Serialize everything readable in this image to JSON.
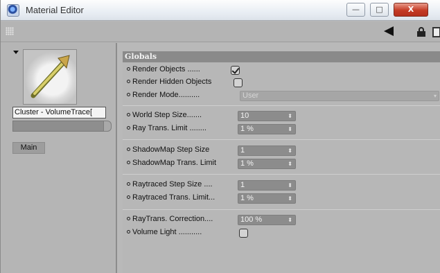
{
  "window": {
    "title": "Material Editor",
    "buttons": {
      "minimize": "—",
      "maximize": "□",
      "close": "X"
    }
  },
  "left": {
    "material_name": "Cluster - VolumeTrace[",
    "tab_main": "Main"
  },
  "globals": {
    "header": "Globals",
    "rows": {
      "render_objects": {
        "label": "Render Objects ......",
        "checked": true
      },
      "render_hidden_objects": {
        "label": "Render Hidden Objects",
        "checked": false
      },
      "render_mode": {
        "label": "Render Mode..........",
        "value": "User"
      },
      "world_step_size": {
        "label": "World Step Size.......",
        "value": "10"
      },
      "ray_trans_limit": {
        "label": "Ray Trans. Limit ........",
        "value": "1 %"
      },
      "shadowmap_step_size": {
        "label": "ShadowMap Step Size",
        "value": "1"
      },
      "shadowmap_trans_limit": {
        "label": "ShadowMap Trans. Limit",
        "value": "1 %"
      },
      "raytraced_step_size": {
        "label": "Raytraced Step Size ....",
        "value": "1"
      },
      "raytraced_trans_limit": {
        "label": "Raytraced Trans. Limit...",
        "value": "1 %"
      },
      "raytrans_correction": {
        "label": "RayTrans. Correction....",
        "value": "100 %"
      },
      "volume_light": {
        "label": "Volume Light ...........",
        "checked": false
      }
    }
  },
  "spinner_glyph": "⬍",
  "dropdown_glyph": "▾"
}
